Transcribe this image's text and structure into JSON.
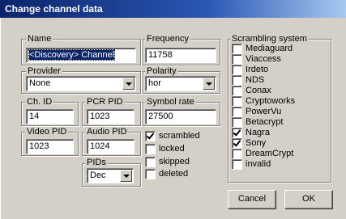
{
  "window": {
    "title": "Change channel data"
  },
  "name": {
    "label": "Name",
    "value": "<Discovery> Channel"
  },
  "frequency": {
    "label": "Frequency",
    "value": "11758"
  },
  "provider": {
    "label": "Provider",
    "value": "None"
  },
  "polarity": {
    "label": "Polarity",
    "value": "hor"
  },
  "ch_id": {
    "label": "Ch. ID",
    "value": "14"
  },
  "pcr_pid": {
    "label": "PCR PID",
    "value": "1023"
  },
  "symbol_rate": {
    "label": "Symbol rate",
    "value": "27500"
  },
  "video_pid": {
    "label": "Video PID",
    "value": "1023"
  },
  "audio_pid": {
    "label": "Audio PID",
    "value": "1024"
  },
  "pids": {
    "label": "PIDs",
    "value": "Dec"
  },
  "flags": [
    {
      "label": "scrambled",
      "checked": true
    },
    {
      "label": "locked",
      "checked": false
    },
    {
      "label": "skipped",
      "checked": false
    },
    {
      "label": "deleted",
      "checked": false
    }
  ],
  "scrambling": {
    "label": "Scrambling system",
    "items": [
      {
        "label": "Mediaguard",
        "checked": false
      },
      {
        "label": "Viaccess",
        "checked": false
      },
      {
        "label": "Irdeto",
        "checked": false
      },
      {
        "label": "NDS",
        "checked": false
      },
      {
        "label": "Conax",
        "checked": false
      },
      {
        "label": "Cryptoworks",
        "checked": false
      },
      {
        "label": "PowerVu",
        "checked": false
      },
      {
        "label": "Betacrypt",
        "checked": false
      },
      {
        "label": "Nagra",
        "checked": true
      },
      {
        "label": "Sony",
        "checked": true
      },
      {
        "label": "DreamCrypt",
        "checked": false
      },
      {
        "label": "invalid",
        "checked": false
      }
    ]
  },
  "buttons": {
    "cancel": "Cancel",
    "ok": "OK"
  }
}
